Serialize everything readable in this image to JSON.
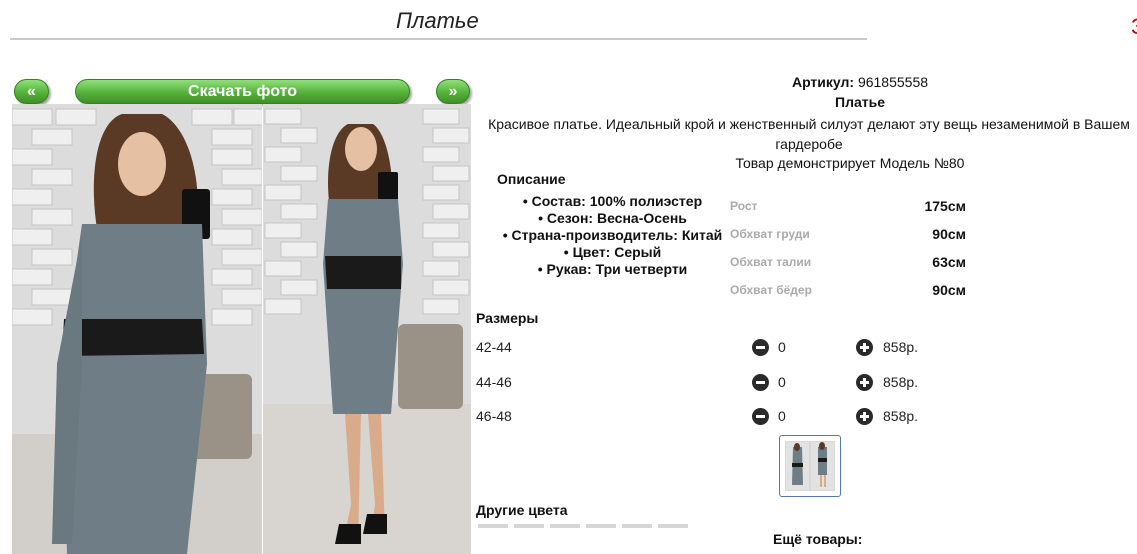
{
  "page": {
    "title": "Платье",
    "edge_fragment": "З"
  },
  "gallery": {
    "prev_label": "«",
    "download_label": "Скачать фото",
    "next_label": "»"
  },
  "product": {
    "article_label": "Артикул:",
    "article_value": "961855558",
    "name": "Платье",
    "description": "Красивое платье. Идеальный крой и женственный силуэт делают эту вещь незаменимой в Вашем гардеробе",
    "model_note": "Товар демонстрирует Модель №80"
  },
  "description": {
    "heading": "Описание",
    "items": [
      "Состав: 100% полиэстер",
      "Сезон: Весна-Осень",
      "Страна-производитель: Китай",
      "Цвет: Серый",
      "Рукав: Три четверти"
    ]
  },
  "measurements": [
    {
      "label": "Рост",
      "value": "175см"
    },
    {
      "label": "Обхват груди",
      "value": "90см"
    },
    {
      "label": "Обхват талии",
      "value": "63см"
    },
    {
      "label": "Обхват бёдер",
      "value": "90см"
    }
  ],
  "sizes": {
    "heading": "Размеры",
    "rows": [
      {
        "size": "42-44",
        "qty": "0",
        "price": "858р."
      },
      {
        "size": "44-46",
        "qty": "0",
        "price": "858р."
      },
      {
        "size": "46-48",
        "qty": "0",
        "price": "858р."
      }
    ]
  },
  "other": {
    "colors_heading": "Другие цвета",
    "more_heading": "Ещё товары:"
  },
  "colors": {
    "accent_red": "#c00000",
    "button_green": "#55b23a",
    "dress_gray": "#6f7d86"
  }
}
